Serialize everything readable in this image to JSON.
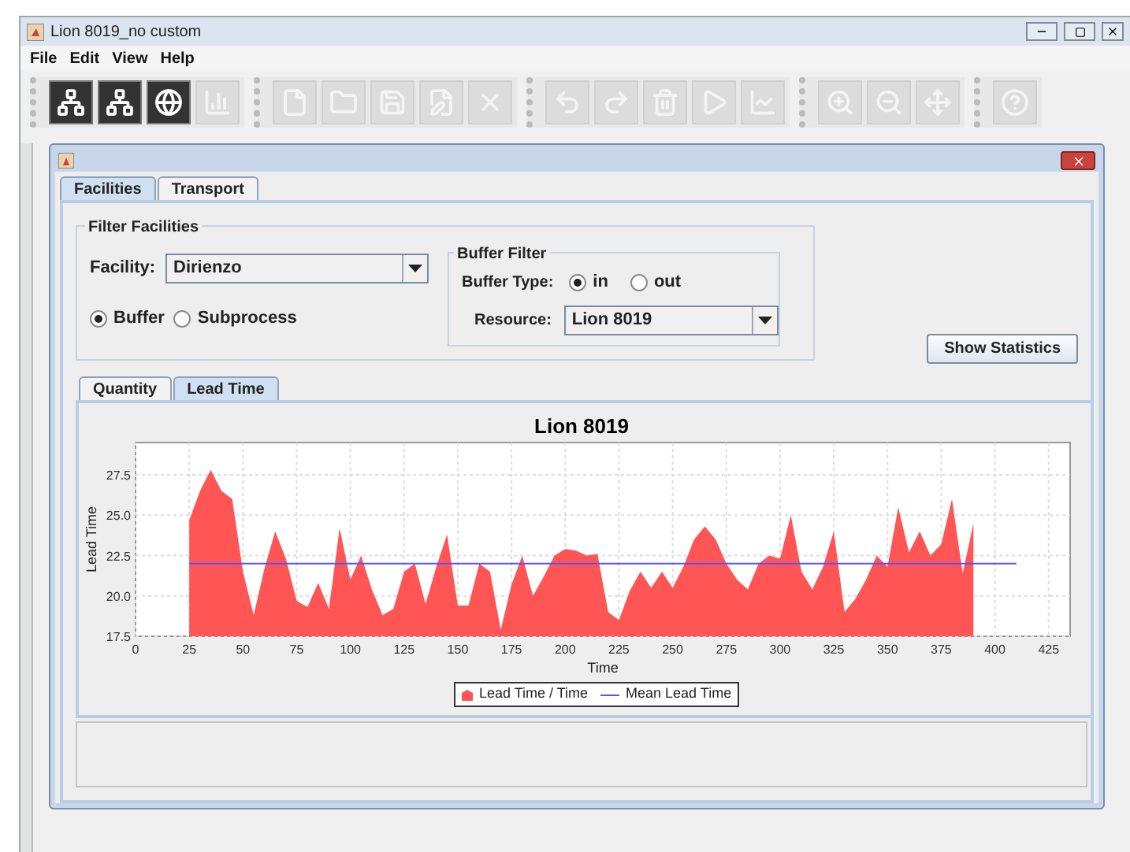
{
  "window": {
    "title": "Lion 8019_no custom"
  },
  "menu": [
    "File",
    "Edit",
    "View",
    "Help"
  ],
  "toolbar": [
    [
      {
        "enabled": true
      },
      {
        "enabled": true
      },
      {
        "enabled": true
      },
      {
        "enabled": false
      }
    ],
    [
      {
        "enabled": false
      },
      {
        "enabled": false
      },
      {
        "enabled": false
      },
      {
        "enabled": false
      },
      {
        "enabled": false
      }
    ],
    [
      {
        "enabled": false
      },
      {
        "enabled": false
      },
      {
        "enabled": false
      },
      {
        "enabled": false
      },
      {
        "enabled": false
      }
    ],
    [
      {
        "enabled": false
      },
      {
        "enabled": false
      },
      {
        "enabled": false
      }
    ],
    [
      {
        "enabled": false
      }
    ]
  ],
  "tabs": [
    {
      "label": "Facilities",
      "selected": true
    },
    {
      "label": "Transport",
      "selected": false
    }
  ],
  "filter_facilities": {
    "title": "Filter Facilities",
    "facility_label": "Facility:",
    "facility_value": "Dirienzo",
    "options": [
      {
        "label": "Buffer",
        "selected": true
      },
      {
        "label": "Subprocess",
        "selected": false
      }
    ]
  },
  "buffer_filter": {
    "title": "Buffer Filter",
    "type_label": "Buffer Type:",
    "types": [
      {
        "label": "in",
        "selected": true
      },
      {
        "label": "out",
        "selected": false
      }
    ],
    "resource_label": "Resource:",
    "resource_value": "Lion 8019"
  },
  "show_statistics_button": "Show Statistics",
  "chart_tabs": [
    {
      "label": "Quantity",
      "selected": false
    },
    {
      "label": "Lead Time",
      "selected": true
    }
  ],
  "chart_data": {
    "type": "area",
    "title": "Lion 8019",
    "xlabel": "Time",
    "ylabel": "Lead Time",
    "x": [
      25,
      30,
      35,
      40,
      45,
      50,
      55,
      60,
      65,
      70,
      75,
      80,
      85,
      90,
      95,
      100,
      105,
      110,
      115,
      120,
      125,
      130,
      135,
      140,
      145,
      150,
      155,
      160,
      165,
      170,
      175,
      180,
      185,
      190,
      195,
      200,
      205,
      210,
      215,
      220,
      225,
      230,
      235,
      240,
      245,
      250,
      255,
      260,
      265,
      270,
      275,
      280,
      285,
      290,
      295,
      300,
      305,
      310,
      315,
      320,
      325,
      330,
      335,
      340,
      345,
      350,
      355,
      360,
      365,
      370,
      375,
      380,
      385,
      390,
      395,
      400,
      405,
      410
    ],
    "series": [
      {
        "name": "Lead Time / Time",
        "type": "area",
        "color": "#ff5555",
        "values": [
          24.7,
          26.5,
          27.8,
          26.5,
          26.0,
          21.5,
          18.8,
          21.7,
          24.0,
          22.3,
          19.7,
          19.3,
          20.8,
          19.2,
          24.2,
          21.0,
          22.5,
          20.4,
          18.8,
          19.2,
          21.5,
          22.0,
          19.5,
          21.8,
          23.8,
          19.4,
          19.4,
          22.0,
          21.5,
          17.9,
          20.7,
          22.5,
          20.0,
          21.2,
          22.5,
          22.9,
          22.8,
          22.5,
          22.6,
          19.0,
          18.5,
          20.3,
          21.5,
          20.5,
          21.5,
          20.5,
          21.8,
          23.5,
          24.3,
          23.5,
          22.0,
          21.0,
          20.4,
          22.0,
          22.5,
          22.3,
          25.0,
          21.5,
          20.4,
          21.8,
          24.0,
          19.0,
          19.8,
          21.0,
          22.5,
          21.8,
          25.5,
          22.7,
          24.0,
          22.5,
          23.2,
          26.0,
          21.4,
          24.5,
          null,
          null,
          null,
          null
        ]
      },
      {
        "name": "Mean Lead Time",
        "type": "line",
        "color": "#5555ff",
        "values": [
          22,
          22,
          22,
          22,
          22,
          22,
          22,
          22,
          22,
          22,
          22,
          22,
          22,
          22,
          22,
          22,
          22,
          22,
          22,
          22,
          22,
          22,
          22,
          22,
          22,
          22,
          22,
          22,
          22,
          22,
          22,
          22,
          22,
          22,
          22,
          22,
          22,
          22,
          22,
          22,
          22,
          22,
          22,
          22,
          22,
          22,
          22,
          22,
          22,
          22,
          22,
          22,
          22,
          22,
          22,
          22,
          22,
          22,
          22,
          22,
          22,
          22,
          22,
          22,
          22,
          22,
          22,
          22,
          22,
          22,
          22,
          22,
          22,
          22,
          22,
          22,
          22,
          22
        ]
      }
    ],
    "grid": true,
    "legend": true,
    "xlim": [
      0,
      435
    ],
    "ylim": [
      17.5,
      29.5
    ],
    "xticks": [
      0,
      25,
      50,
      75,
      100,
      125,
      150,
      175,
      200,
      225,
      250,
      275,
      300,
      325,
      350,
      375,
      400,
      425
    ],
    "yticks": [
      {
        "value": 17.5,
        "label": "17.5"
      },
      {
        "value": 20,
        "label": "20.0"
      },
      {
        "value": 22.5,
        "label": "22.5"
      },
      {
        "value": 25,
        "label": "25.0"
      },
      {
        "value": 27.5,
        "label": "27.5"
      }
    ]
  }
}
